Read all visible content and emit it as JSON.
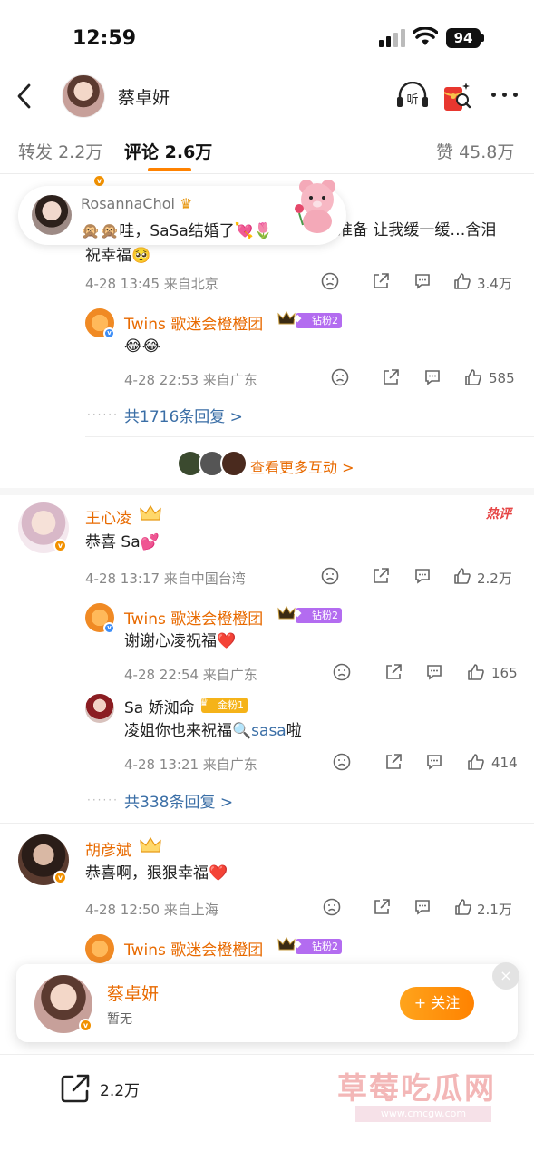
{
  "status": {
    "time": "12:59",
    "battery": "94"
  },
  "header": {
    "title": "蔡卓妍"
  },
  "header_actions": {
    "listen_icon_text": "听"
  },
  "tabs": [
    {
      "label": "转发",
      "count": "2.2万"
    },
    {
      "label": "评论",
      "count": "2.6万"
    },
    {
      "label": "赞",
      "count": "45.8万"
    }
  ],
  "popup": {
    "name": "RosannaChoi",
    "text": "哇，SaSa结婚了"
  },
  "comment0": {
    "text_line1": "准备 让我缓一缓…含泪",
    "text_line2": "祝幸福",
    "meta": "4-28 13:45  来自北京",
    "likes": "3.4万",
    "reply": {
      "user": "Twins 歌迷会橙橙团",
      "badge": "钻粉2",
      "text": "😂😂",
      "meta": "4-28 22:53  来自广东",
      "likes": "585"
    },
    "more_replies": "共1716条回复 >"
  },
  "interact_more": "查看更多互动 >",
  "comment1": {
    "user": "王心凌",
    "hot": "热评",
    "text": "恭喜 Sa💕",
    "meta": "4-28 13:17  来自中国台湾",
    "likes": "2.2万",
    "replies": [
      {
        "user": "Twins 歌迷会橙橙团",
        "badge": "钻粉2",
        "text": "谢谢心凌祝福❤️",
        "meta": "4-28 22:54  来自广东",
        "likes": "165"
      },
      {
        "user": "Sa 娇洳命",
        "badge": "金粉1",
        "text_prefix": "凌姐你也来祝福",
        "search_term": "sasa",
        "text_suffix": "啦",
        "meta": "4-28 13:21  来自广东",
        "likes": "414"
      }
    ],
    "more_replies": "共338条回复 >"
  },
  "comment2": {
    "user": "胡彦斌",
    "text": "恭喜啊，狠狠幸福❤️",
    "meta": "4-28 12:50  来自上海",
    "likes": "2.1万",
    "reply": {
      "user": "Twins 歌迷会橙橙团",
      "badge": "钻粉2"
    }
  },
  "follow_card": {
    "name": "蔡卓妍",
    "subtitle": "暂无",
    "button": "+ 关注",
    "close": "×"
  },
  "bottom": {
    "repost_count": "2.2万"
  },
  "watermark": {
    "text": "草莓吃瓜网",
    "url": "www.cmcgw.com"
  },
  "colors": {
    "accent": "#ff8200",
    "username": "#e86a00",
    "link": "#3a6ea6"
  }
}
